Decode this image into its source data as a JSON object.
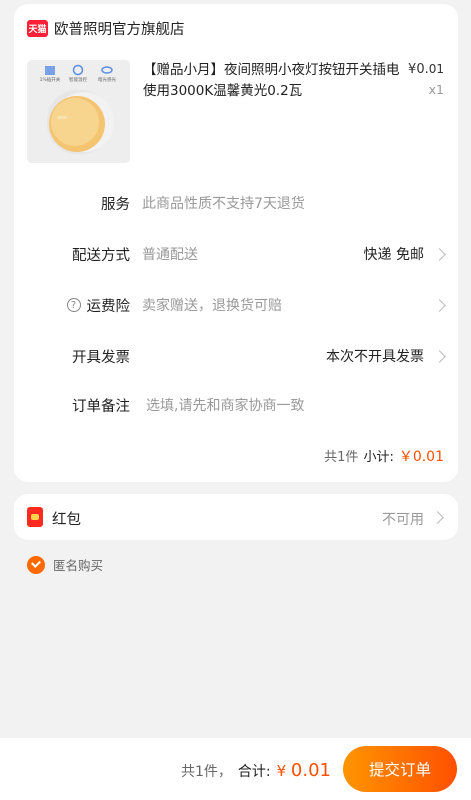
{
  "shop": {
    "badge": "天猫",
    "store_name": "欧普照明官方旗舰店"
  },
  "product": {
    "image_labels": [
      "1%插开关",
      "智能温控",
      "暗光感光"
    ],
    "title": "【赠品小月】夜间照明小夜灯按钮开关插电使用3000K温馨黄光0.2瓦",
    "price_symbol": "¥",
    "price_int": "0.",
    "price_dec": "01",
    "qty": "x1"
  },
  "rows": {
    "service": {
      "label": "服务",
      "value": "此商品性质不支持7天退货"
    },
    "delivery": {
      "label": "配送方式",
      "value": "普通配送",
      "right": "快递 免邮"
    },
    "shipping_insurance": {
      "icon": "?",
      "label": "运费险",
      "value": "卖家赠送，退换货可赔"
    },
    "invoice": {
      "label": "开具发票",
      "right": "本次不开具发票"
    },
    "remark": {
      "label": "订单备注",
      "placeholder": "选填,请先和商家协商一致"
    }
  },
  "subtotal": {
    "count": "共1件",
    "label": "小计:",
    "value": "￥0.01"
  },
  "red_packet": {
    "label": "红包",
    "value": "不可用"
  },
  "anonymous": {
    "label": "匿名购买",
    "checked": true
  },
  "footer": {
    "count": "共1件，",
    "total_label": "合计:",
    "symbol": "¥",
    "amount": "0.01",
    "submit_label": "提交订单"
  },
  "colors": {
    "accent": "#ff5000",
    "tmall_red": "#ff1f36"
  }
}
